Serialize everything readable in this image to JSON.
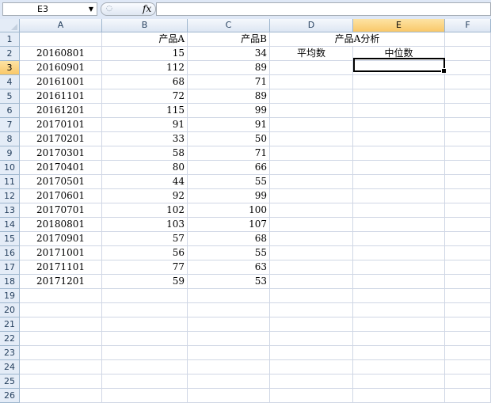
{
  "name_box": "E3",
  "fx_label": "fx",
  "formula": "",
  "columns": [
    "A",
    "B",
    "C",
    "D",
    "E",
    "F"
  ],
  "rows": [
    "1",
    "2",
    "3",
    "4",
    "5",
    "6",
    "7",
    "8",
    "9",
    "10",
    "11",
    "12",
    "13",
    "14",
    "15",
    "16",
    "17",
    "18",
    "19",
    "20",
    "21",
    "22",
    "23",
    "24",
    "25",
    "26"
  ],
  "headers": {
    "b1": "产品A",
    "c1": "产品B",
    "de1": "产品A分析",
    "d2": "平均数",
    "e2": "中位数"
  },
  "data": [
    [
      "20160801",
      "15",
      "34"
    ],
    [
      "20160901",
      "112",
      "89"
    ],
    [
      "20161001",
      "68",
      "71"
    ],
    [
      "20161101",
      "72",
      "89"
    ],
    [
      "20161201",
      "115",
      "99"
    ],
    [
      "20170101",
      "91",
      "91"
    ],
    [
      "20170201",
      "33",
      "50"
    ],
    [
      "20170301",
      "58",
      "71"
    ],
    [
      "20170401",
      "80",
      "66"
    ],
    [
      "20170501",
      "44",
      "55"
    ],
    [
      "20170601",
      "92",
      "99"
    ],
    [
      "20170701",
      "102",
      "100"
    ],
    [
      "20180801",
      "103",
      "107"
    ],
    [
      "20170901",
      "57",
      "68"
    ],
    [
      "20171001",
      "56",
      "55"
    ],
    [
      "20171101",
      "77",
      "63"
    ],
    [
      "20171201",
      "59",
      "53"
    ]
  ],
  "selected_cell": "E3"
}
